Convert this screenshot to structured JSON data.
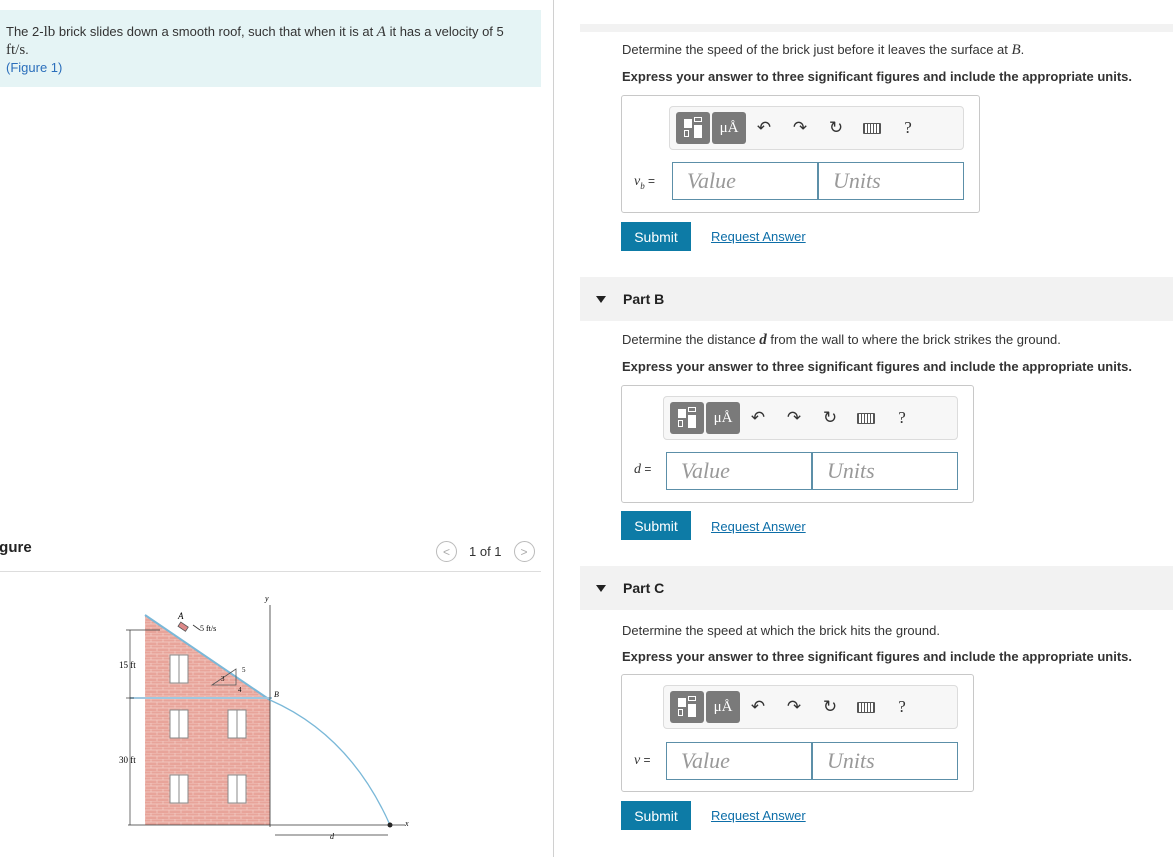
{
  "problem": {
    "text_1": "The 2-",
    "lb": "lb",
    "text_2": " brick slides down a smooth roof, such that when it is at ",
    "point_a": "A",
    "text_3": " it has a velocity of 5",
    "units": "ft/s",
    "period": ".",
    "figure_link": "(Figure 1)"
  },
  "figure_panel": {
    "title": "igure",
    "counter": "1 of 1",
    "labels": {
      "a": "A",
      "v": "5 ft/s",
      "y": "y",
      "b": "B",
      "slope_3": "3",
      "slope_4": "4",
      "slope_5": "5",
      "h1": "15 ft",
      "h2": "30 ft",
      "d": "d",
      "x": "x"
    }
  },
  "parts": [
    {
      "title": "",
      "question_pre": "Determine the speed of the brick just before it leaves the surface at ",
      "question_var": "B",
      "question_post": ".",
      "instruction": "Express your answer to three significant figures and include the appropriate units.",
      "var_label": "v",
      "var_sub": "b",
      "eq": " =",
      "value_placeholder": "Value",
      "units_placeholder": "Units",
      "submit": "Submit",
      "request": "Request Answer"
    },
    {
      "title": "Part B",
      "question_pre": "Determine the distance ",
      "question_var": "d",
      "question_post": " from the wall to where the brick strikes the ground.",
      "instruction": "Express your answer to three significant figures and include the appropriate units.",
      "var_label": "d",
      "var_sub": "",
      "eq": " =",
      "value_placeholder": "Value",
      "units_placeholder": "Units",
      "submit": "Submit",
      "request": "Request Answer"
    },
    {
      "title": "Part C",
      "question_pre": "Determine the speed at which the brick hits the ground.",
      "question_var": "",
      "question_post": "",
      "instruction": "Express your answer to three significant figures and include the appropriate units.",
      "var_label": "v",
      "var_sub": "",
      "eq": " =",
      "value_placeholder": "Value",
      "units_placeholder": "Units",
      "submit": "Submit",
      "request": "Request Answer"
    }
  ],
  "toolbar": {
    "units_symbol": "μÅ",
    "help": "?"
  },
  "icons": {
    "templates": "templates-icon",
    "units": "units-icon",
    "undo": "undo-icon",
    "redo": "redo-icon",
    "reset": "reset-icon",
    "keyboard": "keyboard-icon",
    "help": "help-icon",
    "collapse": "caret-down-icon"
  },
  "colors": {
    "problem_bg": "#e5f4f5",
    "submit_bg": "#0d7ba6",
    "link": "#0d6ea8",
    "input_border": "#5c8fa8",
    "part_bar_bg": "#f2f2f2"
  }
}
